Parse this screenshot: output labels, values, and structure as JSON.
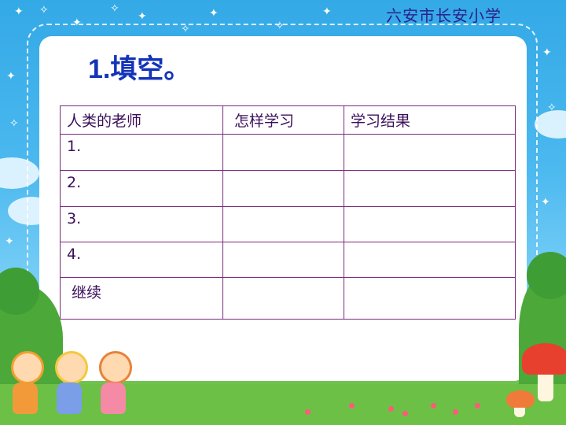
{
  "header": {
    "school_name": "六安市长安小学"
  },
  "slide": {
    "title": "1.填空。"
  },
  "table": {
    "headers": [
      "人类的老师",
      "怎样学习",
      "学习结果"
    ],
    "rows": [
      [
        "1.",
        "",
        ""
      ],
      [
        "2.",
        "",
        ""
      ],
      [
        "3.",
        "",
        ""
      ],
      [
        "4.",
        "",
        ""
      ],
      [
        " 继续",
        "",
        ""
      ]
    ]
  }
}
